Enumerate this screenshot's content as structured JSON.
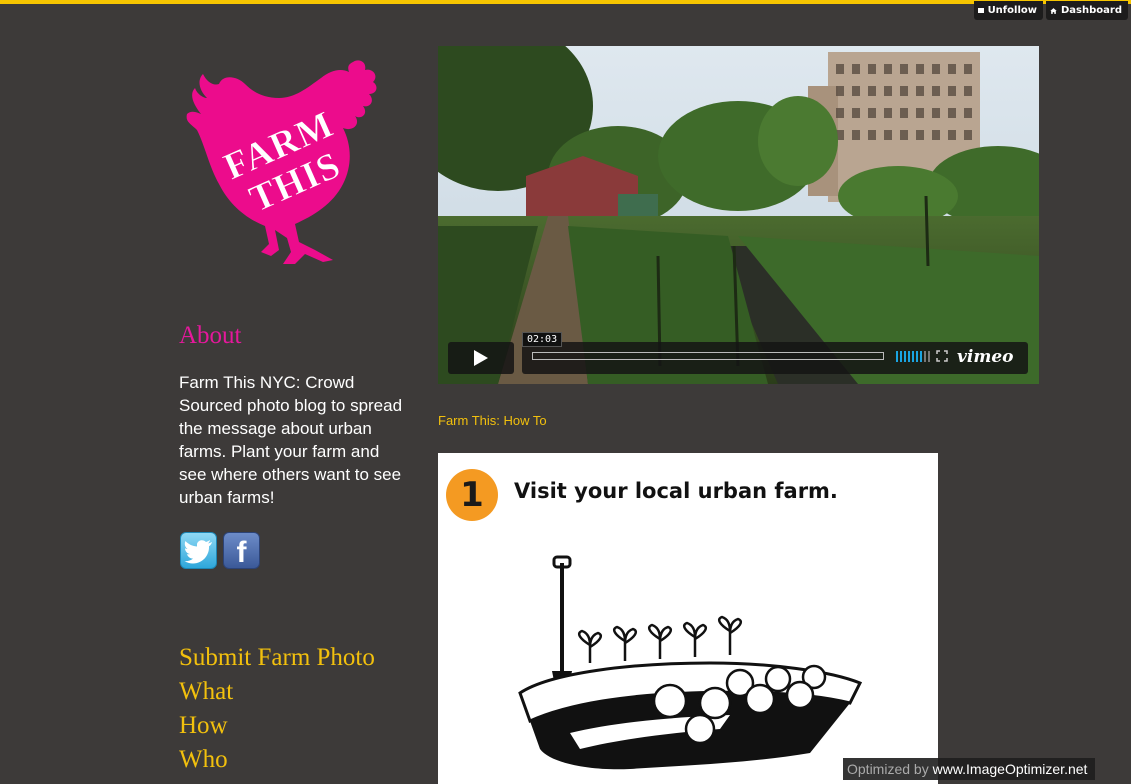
{
  "topbar": {
    "unfollow_label": "Unfollow",
    "dashboard_label": "Dashboard",
    "accent_color": "#f6c500"
  },
  "logo": {
    "brand_text_line1": "FARM",
    "brand_text_line2": "THIS",
    "color": "#ec0c8c"
  },
  "sidebar": {
    "about_title": "About",
    "about_text": "Farm This NYC: Crowd Sourced photo blog to spread the message about urban farms. Plant your farm and see where others want to see urban farms!",
    "social": [
      {
        "name": "twitter",
        "icon": "twitter-icon",
        "glyph": "t"
      },
      {
        "name": "facebook",
        "icon": "facebook-icon",
        "glyph": "f"
      }
    ],
    "nav": [
      {
        "label": "Submit Farm Photo"
      },
      {
        "label": "What"
      },
      {
        "label": "How"
      },
      {
        "label": "Who"
      }
    ]
  },
  "video": {
    "time": "02:03",
    "player": "vimeo",
    "play_icon": "play-icon",
    "fullscreen_icon": "fullscreen-icon"
  },
  "post": {
    "title_link": "Farm This: How To",
    "step_number": "1",
    "step_text": "Visit your local urban farm."
  },
  "watermark": {
    "prefix": "Optimized by",
    "site": "www.ImageOptimizer.net"
  },
  "colors": {
    "background": "#3d3a39",
    "about_title": "#e5189c",
    "links": "#f2c00d",
    "step_circle": "#f49a22"
  }
}
